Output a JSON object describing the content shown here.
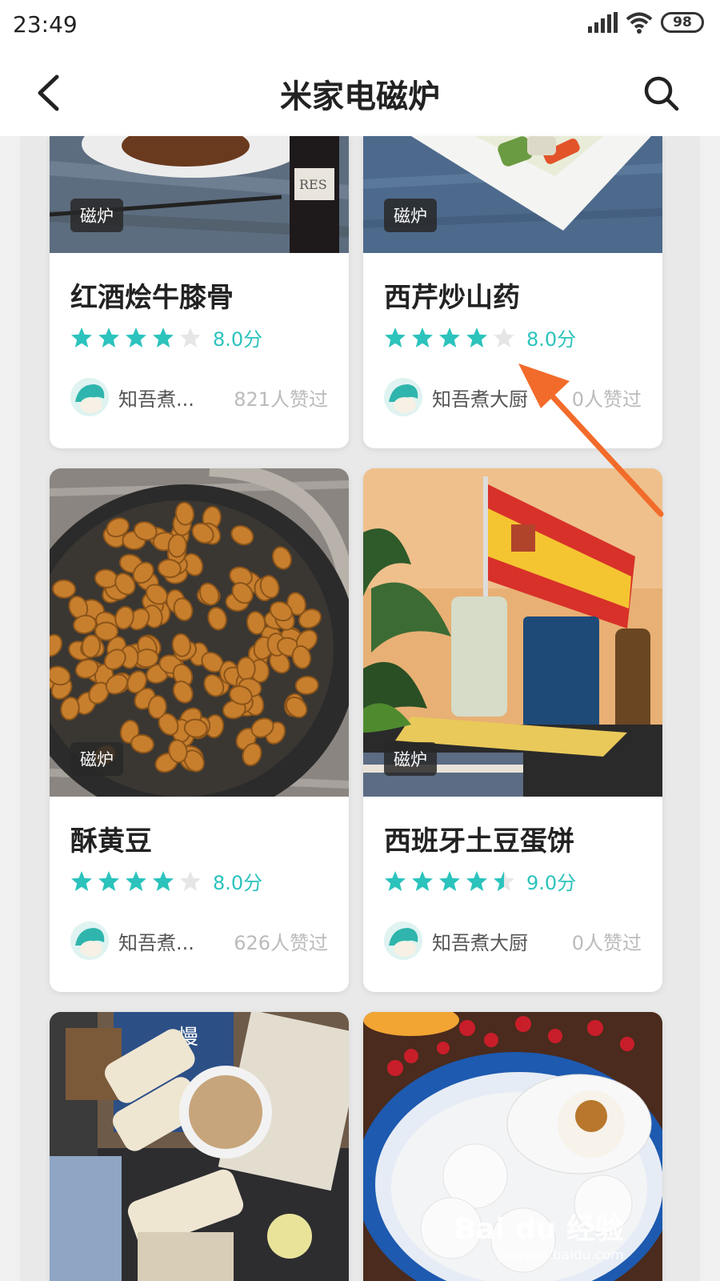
{
  "status_bar": {
    "time": "23:49",
    "battery": "98"
  },
  "header": {
    "title": "米家电磁炉"
  },
  "recipes": [
    {
      "title": "红酒烩牛膝骨",
      "tag": "磁炉",
      "score": "8.0分",
      "stars": 4,
      "author": "知吾煮...",
      "likes": "821人赞过"
    },
    {
      "title": "西芹炒山药",
      "tag": "磁炉",
      "score": "8.0分",
      "stars": 4,
      "author": "知吾煮大厨",
      "likes": "0人赞过"
    },
    {
      "title": "酥黄豆",
      "tag": "磁炉",
      "score": "8.0分",
      "stars": 4,
      "author": "知吾煮...",
      "likes": "626人赞过"
    },
    {
      "title": "西班牙土豆蛋饼",
      "tag": "磁炉",
      "score": "9.0分",
      "stars": 4.5,
      "author": "知吾煮大厨",
      "likes": "0人赞过"
    }
  ],
  "watermark": {
    "main": "Bai du 经验",
    "sub": "jingyan.baidu.com"
  },
  "colors": {
    "accent": "#2cc3bd",
    "star_empty": "#e6e6e6",
    "arrow": "#f26b2a"
  },
  "icons": {
    "back": "chevron-left-icon",
    "search": "search-icon",
    "star": "star-icon"
  }
}
